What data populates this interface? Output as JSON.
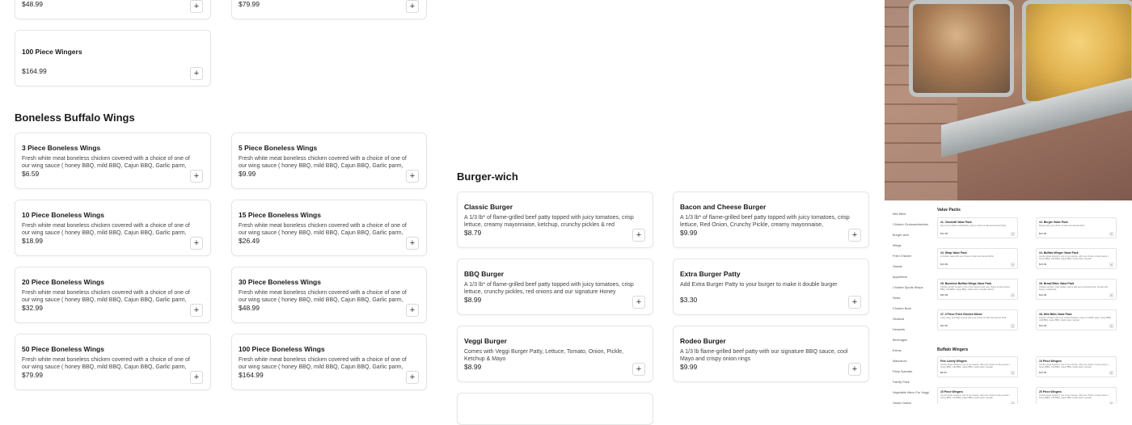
{
  "wings_extra": {
    "top_prices": [
      "$48.99",
      "$79.99"
    ],
    "wingers_100": {
      "title": "100 Piece Wingers",
      "price": "$164.99"
    }
  },
  "boneless": {
    "heading": "Boneless Buffalo Wings",
    "items": [
      {
        "title": "3 Piece Boneless Wings",
        "desc": "Fresh white meat boneless chicken covered with a choice of one of our wing sauce ( honey BBQ, mild BBQ, Cajun BBQ, Garlic parm,",
        "price": "$6.59"
      },
      {
        "title": "5 Piece Boneless Wings",
        "desc": "Fresh white meat boneless chicken covered with a choice of one of our wing sauce ( honey BBQ, mild BBQ, Cajun BBQ, Garlic parm,",
        "price": "$9.99"
      },
      {
        "title": "10 Piece Boneless Wings",
        "desc": "Fresh white meat boneless chicken covered with a choice of one of our wing sauce ( honey BBQ, mild BBQ, Cajun BBQ, Garlic parm,",
        "price": "$18.99"
      },
      {
        "title": "15 Piece Boneless Wings",
        "desc": "Fresh white meat boneless chicken covered with a choice of one of our wing sauce ( honey BBQ, mild BBQ, Cajun BBQ, Garlic parm,",
        "price": "$26.49"
      },
      {
        "title": "20 Piece Boneless Wings",
        "desc": "Fresh white meat boneless chicken covered with a choice of one of our wing sauce ( honey BBQ, mild BBQ, Cajun BBQ, Garlic parm,",
        "price": "$32.99"
      },
      {
        "title": "30 Piece Boneless Wings",
        "desc": "Fresh white meat boneless chicken covered with a choice of one of our wing sauce ( honey BBQ, mild BBQ, Cajun BBQ, Garlic parm,",
        "price": "$48.99"
      },
      {
        "title": "50 Piece Boneless Wings",
        "desc": "Fresh white meat boneless chicken covered with a choice of one of our wing sauce ( honey BBQ, mild BBQ, Cajun BBQ, Garlic parm,",
        "price": "$79.99"
      },
      {
        "title": "100 Piece Boneless Wings",
        "desc": "Fresh white meat boneless chicken covered with a choice of one of our wing sauce ( honey BBQ, mild BBQ, Cajun BBQ, Garlic parm,",
        "price": "$164.99"
      }
    ]
  },
  "burgers": {
    "heading": "Burger-wich",
    "items": [
      {
        "title": "Classic Burger",
        "desc": "A 1/3 lb* of flame-grilled beef patty topped with juicy tomatoes, crisp lettuce, creamy mayonnaise, ketchup, crunchy pickles & red",
        "price": "$8.79"
      },
      {
        "title": "Bacon and Cheese Burger",
        "desc": "A 1/3 lb* of flame-grilled beef patty topped with juicy tomatoes, crisp lettuce, Red Onion, Crunchy Pickle, creamy mayonnaise,",
        "price": "$9.99"
      },
      {
        "title": "BBQ Burger",
        "desc": "A 1/3 lb* of flame-grilled beef patty topped with juicy tomatoes, crisp lettuce, crunchy pickles, red onions and our signature Honey",
        "price": "$8.99"
      },
      {
        "title": "Extra Burger Patty",
        "desc": "Add Extra Burger Patty to your burger to make it double burger",
        "price": "$3.30"
      },
      {
        "title": "Veggi Burger",
        "desc": "Comes with Veggi Burger Patty, Lettuce, Tomato, Onion, Pickle, Ketchup & Mayo",
        "price": "$8.99"
      },
      {
        "title": "Rodeo Burger",
        "desc": "A 1/3 lb flame-grilled beef patty with our signature BBQ sauce, cool Mayo and crispy onion rings",
        "price": "$9.99"
      }
    ]
  },
  "add_symbol": "+",
  "mini_preview": {
    "nav": [
      "Mini Bites",
      "Chicken Clucksandwiches",
      "Burger-wich",
      "Wings",
      "Fried Chicken",
      "Salads",
      "Appetizers",
      "Chicken Spuds Wrapz",
      "Sides",
      "Chicken Bowl",
      "Seafood",
      "Desserts",
      "Beverages",
      "Extras",
      "Mascaroni",
      "Party Specials",
      "Family Pack",
      "Vegetable Menu For Veggi",
      "Vegan Option"
    ],
    "value_packs_title": "Value Packs",
    "value_packs": [
      {
        "t": "#1- Clucketti Value Pack",
        "d": "Any of our chicken sandwiches, with a choice of side and canned drink",
        "p": "$12.99"
      },
      {
        "t": "#2- Burger Value Pack",
        "d": "Burger with your choice of side and canned drink",
        "p": "$12.99"
      },
      {
        "t": "#3- Wrap Value Pack",
        "d": "A chicken wrap with your choice of side and canned drink",
        "p": "$13.99"
      },
      {
        "t": "#4- Buffalo Winger Value Pack",
        "d": "Jumbo wings tossed in one of our sauces, with your choice of wing sauce ( honey BBQ, mild BBQ, Cajun BBQ, Garlic parm, teriyaki",
        "p": "$13.99"
      },
      {
        "t": "#5- Boneless Buffalo Wings Value Pack",
        "d": "Chicken tender tossed in one of our sauces with your choice of wing honey BBQ, mild BBQ, Cajun BBQ, Garlic parm, teriyaki, Atomic",
        "p": "$10.99"
      },
      {
        "t": "#6- Bread Bites Value Pack",
        "d": "Chicken tenders, fried golden, with a side and a canned drink. Served with honey mustard dip",
        "p": "$10.99"
      },
      {
        "t": "#7- 3 Piece Fried Chicken Mixed",
        "d": "A leg, wing, and thigh served with your choice of side and canned drink",
        "p": "$11.99"
      },
      {
        "t": "#8- Mini Bites Value Pack",
        "d": "Popcorn chicken with your choice between crispy or buffalo style, honey BBQ, mild BBQ, Cajun BBQ, Garlic parm, teriyaki",
        "p": "$10.99"
      }
    ],
    "buffalo_title": "Buffalo Wingers",
    "buffalo": [
      {
        "t": "Five Lonely Wingers",
        "d": "Jumbo wings tossed in one of our sauces, with your choice of wing sauce ( honey BBQ, mild BBQ, Cajun BBQ, Garlic parm, teriyaki",
        "p": "$8.99"
      },
      {
        "t": "10 Piece Wingers",
        "d": "Jumbo wings tossed in one of our sauces, with your choice of wing sauce ( honey BBQ, mild BBQ, Cajun BBQ, Garlic parm, teriyaki",
        "p": "$16.99"
      },
      {
        "t": "15 Piece Wingers",
        "d": "Jumbo wings tossed in one of our sauces, with your choice of wing sauce ( honey BBQ, mild BBQ, Cajun BBQ, Garlic parm, teriyaki",
        "p": ""
      },
      {
        "t": "20 Piece Wingers",
        "d": "Jumbo wings tossed in one of our sauces, with your choice of wing sauce ( honey BBQ, mild BBQ, Cajun BBQ, Garlic parm, teriyaki",
        "p": ""
      }
    ]
  }
}
